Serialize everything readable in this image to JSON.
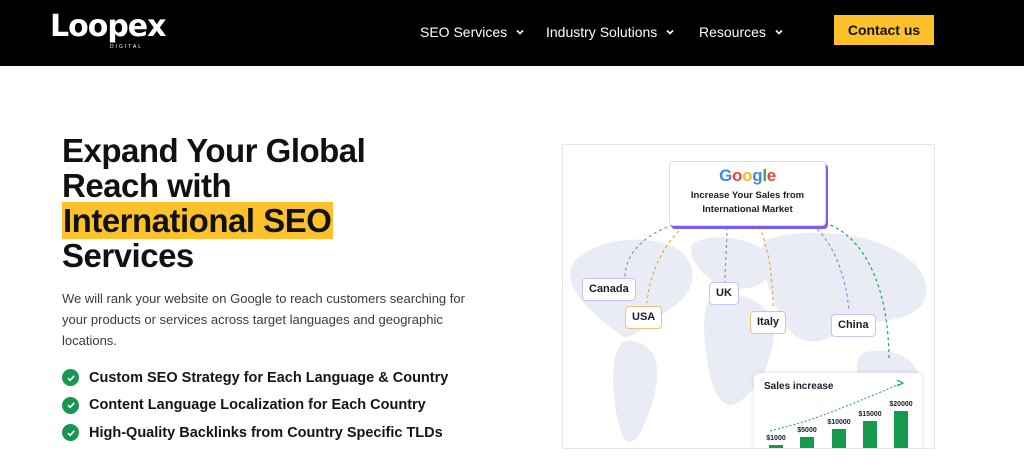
{
  "nav": {
    "logo_text": "Loopex",
    "logo_sub": "DIGITAL",
    "items": [
      {
        "label": "SEO Services"
      },
      {
        "label": "Industry Solutions"
      },
      {
        "label": "Resources"
      }
    ],
    "cta_label": "Contact us"
  },
  "hero": {
    "headline_line1": "Expand Your Global",
    "headline_line2": "Reach with",
    "headline_highlight": "International SEO",
    "headline_line4": "Services",
    "description": "We will rank your website on Google to reach customers searching for your products or services across target languages and geographic locations.",
    "features": [
      "Custom SEO Strategy for Each Language & Country",
      "Content Language Localization for Each Country",
      "High-Quality Backlinks from Country Specific TLDs"
    ]
  },
  "illustration": {
    "google_logo": "Google",
    "google_caption": "Increase Your Sales from International Market",
    "countries": [
      "Canada",
      "USA",
      "UK",
      "Italy",
      "China"
    ],
    "sales_title": "Sales increase",
    "sales_values": [
      "$1000",
      "$5000",
      "$10000",
      "$15000",
      "$20000"
    ]
  },
  "colors": {
    "brand_yellow": "#fdc12b",
    "check_green": "#1a9653",
    "bar_green": "#159a4e",
    "accent_purple": "#7d5cf0"
  }
}
